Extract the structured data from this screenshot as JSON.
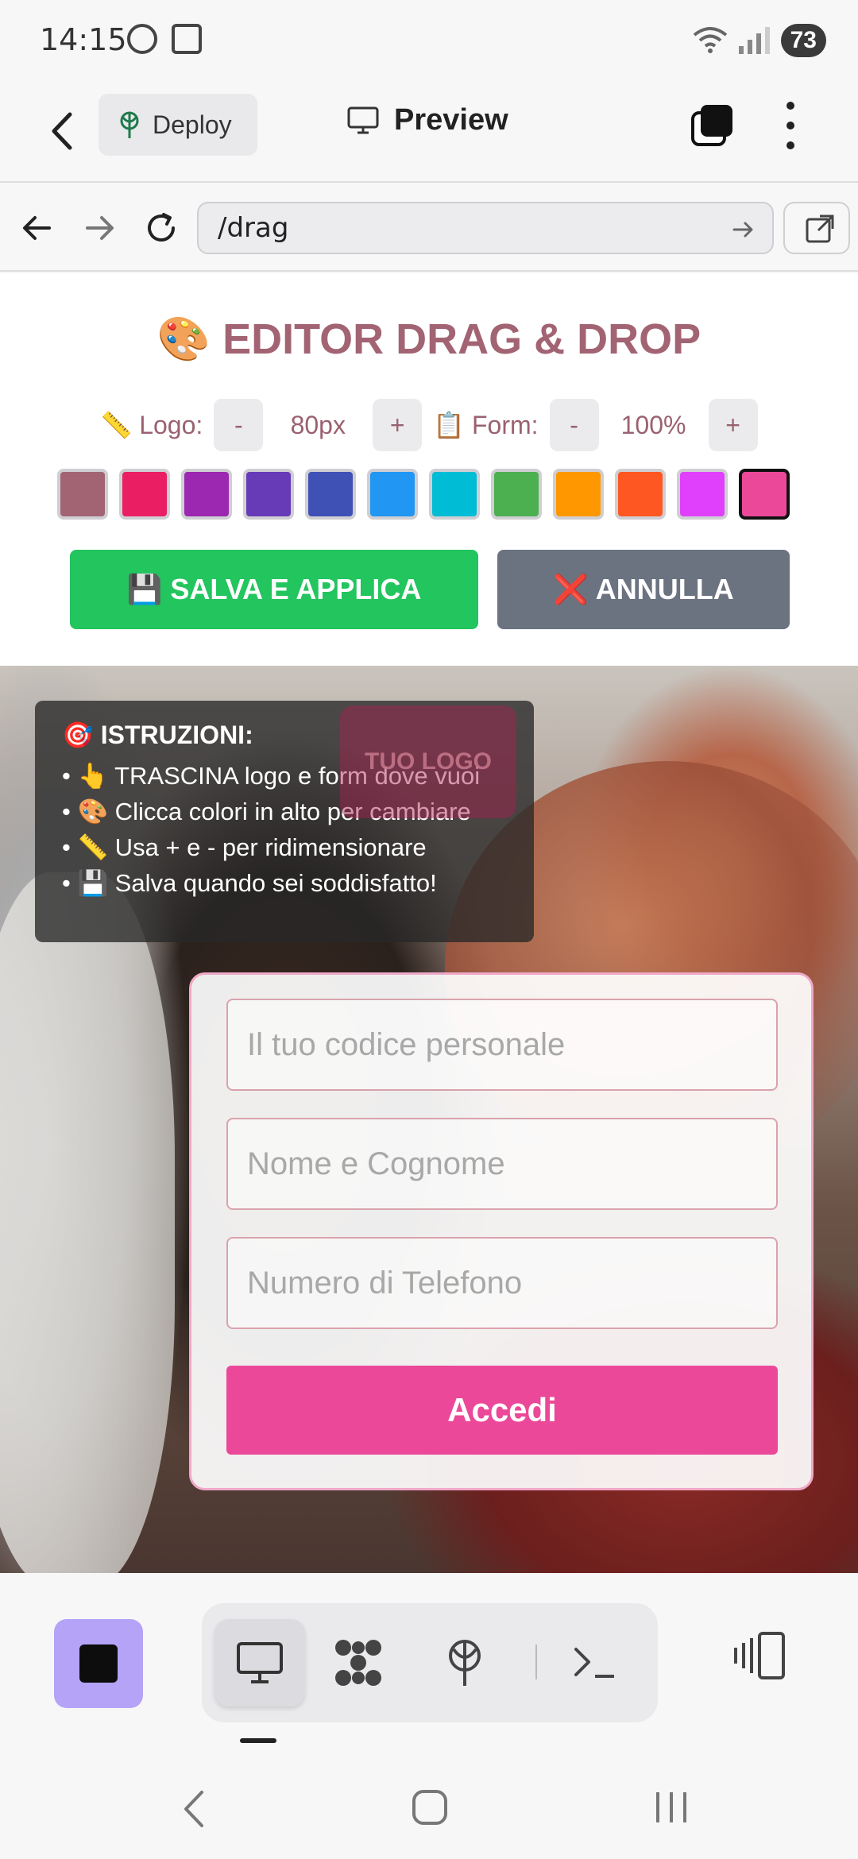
{
  "status_bar": {
    "time": "14:15",
    "battery": "73"
  },
  "app_header": {
    "deploy_label": "Deploy",
    "preview_label": "Preview"
  },
  "browser": {
    "url": "/drag"
  },
  "editor": {
    "title": "🎨 EDITOR DRAG & DROP",
    "logo_label": "📏 Logo:",
    "logo_size": "80px",
    "form_label": "📋 Form:",
    "form_size": "100%",
    "minus": "-",
    "plus": "+",
    "swatches": [
      "#a26473",
      "#e91e63",
      "#9c27b0",
      "#673ab7",
      "#3f51b5",
      "#2196f3",
      "#00bcd4",
      "#4caf50",
      "#ff9800",
      "#ff5722",
      "#e040fb",
      "#ec4899"
    ],
    "selected_swatch": "#ec4899",
    "save_label": "💾 SALVA E APPLICA",
    "cancel_label": "❌ ANNULLA"
  },
  "preview": {
    "logo_text": "TUO LOGO",
    "instructions": {
      "title": "🎯 ISTRUZIONI:",
      "lines": [
        "• 👆 TRASCINA logo e form dove vuoi",
        "• 🎨 Clicca colori in alto per cambiare",
        "• 📏 Usa + e - per ridimensionare",
        "• 💾 Salva quando sei soddisfatto!"
      ]
    },
    "form": {
      "code_placeholder": "Il tuo codice personale",
      "name_placeholder": "Nome e Cognome",
      "phone_placeholder": "Numero di Telefono",
      "submit_label": "Accedi"
    }
  },
  "colors": {
    "accent": "#ec4899",
    "save": "#22c55e",
    "cancel": "#6b7280",
    "title": "#a26473",
    "toolbar_square": "#b4a3f7"
  }
}
